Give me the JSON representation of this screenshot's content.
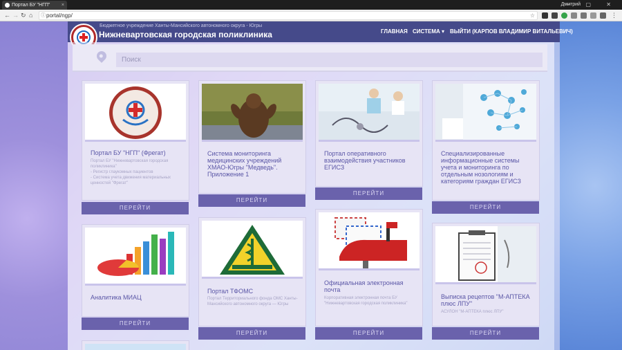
{
  "browser": {
    "tab_title": "Портал БУ \"НГП\"",
    "tab_close": "×",
    "url": "portal/ngp/",
    "profile": "Дмитрий",
    "window_controls": "– ▢ ✕"
  },
  "header": {
    "subtitle": "Бюджетное учреждение Ханты-Мансийского автономного округа - Югры",
    "title": "Нижневартовская городская поликлиника",
    "menu": {
      "home": "ГЛАВНАЯ",
      "system": "СИСТЕМА ▾",
      "logout": "ВЫЙТИ (КАРПОВ ВЛАДИМИР ВИТАЛЬЕВИЧ)"
    }
  },
  "search": {
    "placeholder": "Поиск"
  },
  "cards": [
    {
      "title": "Портал БУ \"НГП\" (Фрегат)",
      "desc": "Портал БУ \"Нижневартовская городская поликлиника\"\n- Регистр глаукомных пациентов\n- Система учета движения материальных ценностей \"Фрегат\"",
      "button": "ПЕРЕЙТИ"
    },
    {
      "title": "Система мониторинга медицинских учреждений ХМАО-Югры \"Медведь\". Приложение 1",
      "desc": "",
      "button": "ПЕРЕЙТИ"
    },
    {
      "title": "Портал оперативного взаимодействия участников ЕГИСЗ",
      "desc": "",
      "button": "ПЕРЕЙТИ"
    },
    {
      "title": "Специализированные информационные системы учета и мониторинга по отдельным нозологиям и категориям граждан ЕГИСЗ",
      "desc": "",
      "button": "ПЕРЕЙТИ"
    },
    {
      "title": "Аналитика МИАЦ",
      "desc": "",
      "button": "ПЕРЕЙТИ"
    },
    {
      "title": "Портал ТФОМС",
      "desc": "Портал Территориального фонда ОМС Ханты-Мансийского автономного округа — Югры",
      "button": "ПЕРЕЙТИ"
    },
    {
      "title": "Официальная электронная почта",
      "desc": "Корпоративная электронная почта БУ \"Нижневартовская городская поликлиника\"",
      "button": "ПЕРЕЙТИ"
    },
    {
      "title": "Выписка рецептов \"М-АПТЕКА плюс ЛПУ\"",
      "desc": "АСУЛОН \"М-АПТЕКА плюс ЛПУ\"",
      "button": "ПЕРЕЙТИ"
    }
  ],
  "colors": {
    "header_bg": "#454a8a",
    "button_bg": "#6a62ac",
    "title_text": "#5a56a6"
  },
  "icons": [
    "back-icon",
    "forward-icon",
    "reload-icon",
    "home-icon",
    "info-icon",
    "star-icon",
    "location-pin-icon"
  ]
}
